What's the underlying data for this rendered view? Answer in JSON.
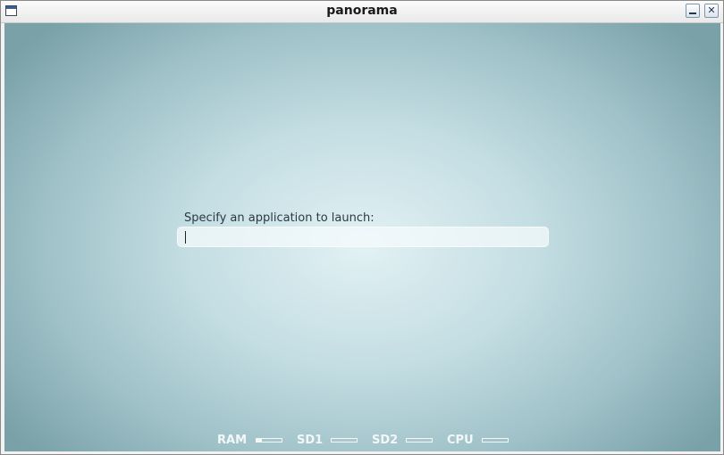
{
  "window": {
    "title": "panorama"
  },
  "launcher": {
    "label": "Specify an application to launch:",
    "input_value": ""
  },
  "statusbar": {
    "items": [
      {
        "label": "RAM",
        "level": 0.2
      },
      {
        "label": "SD1",
        "level": 0
      },
      {
        "label": "SD2",
        "level": 0
      },
      {
        "label": "CPU",
        "level": 0
      }
    ]
  },
  "colors": {
    "background_center": "#e2f1f4",
    "background_edge": "#7aa1a8",
    "status_text": "#f3f7f8"
  }
}
